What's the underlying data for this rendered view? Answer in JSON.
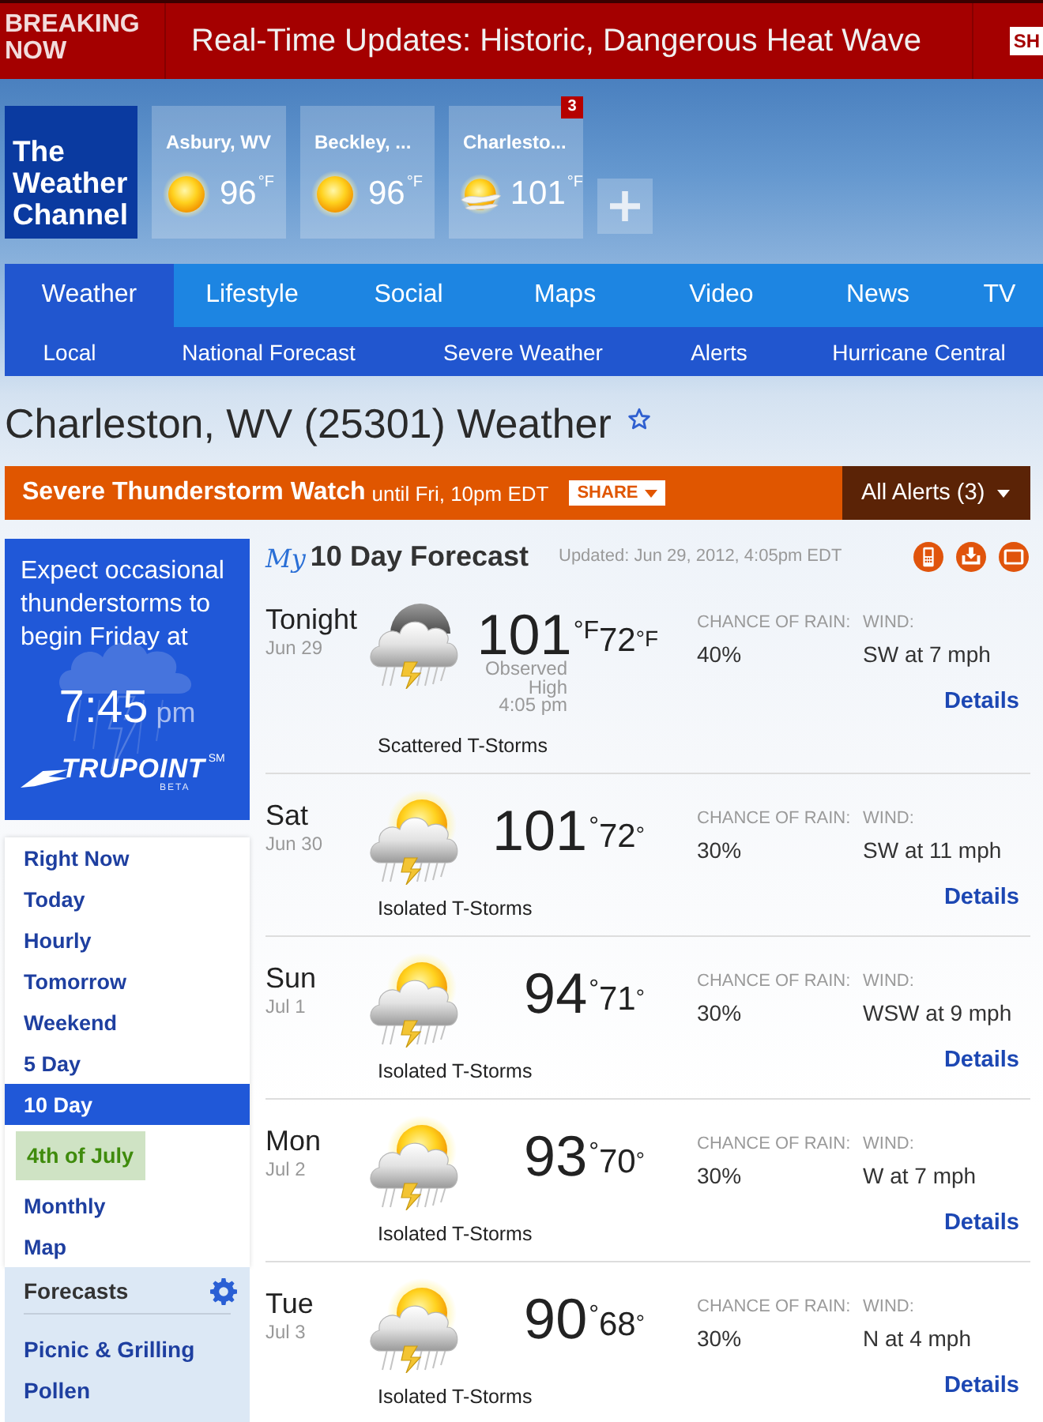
{
  "breaking": {
    "label": "BREAKING NOW",
    "headline": "Real-Time Updates: Historic, Dangerous Heat Wave",
    "share": "SH"
  },
  "logo": {
    "text": "The Weather Channel"
  },
  "locations": [
    {
      "name": "Asbury, WV",
      "temp": "96",
      "unit": "°F",
      "hazy": false
    },
    {
      "name": "Beckley, ...",
      "temp": "96",
      "unit": "°F",
      "hazy": false
    },
    {
      "name": "Charlesto...",
      "temp": "101",
      "unit": "°F",
      "hazy": true,
      "badge": "3"
    }
  ],
  "nav": {
    "tabs": [
      {
        "label": "Weather",
        "selected": true
      },
      {
        "label": "Lifestyle",
        "selected": false
      },
      {
        "label": "Social",
        "selected": false
      },
      {
        "label": "Maps",
        "selected": false
      },
      {
        "label": "Video",
        "selected": false
      },
      {
        "label": "News",
        "selected": false
      },
      {
        "label": "TV",
        "selected": false
      }
    ],
    "subnav": [
      "Local",
      "National Forecast",
      "Severe Weather",
      "Alerts",
      "Hurricane Central"
    ]
  },
  "page_title": "Charleston, WV (25301) Weather",
  "alert": {
    "title": "Severe Thunderstorm Watch",
    "until": "until Fri, 10pm EDT",
    "share": "SHARE",
    "all_alerts": "All Alerts (3)"
  },
  "trupoint": {
    "message": "Expect occasional thunderstorms to begin Friday at",
    "time": "7:45",
    "period": "pm",
    "brand": "TRUPOINT",
    "service_mark": "SM",
    "tag": "BETA"
  },
  "sidebar": {
    "items": [
      {
        "label": "Right Now",
        "kind": "link",
        "selected": false
      },
      {
        "label": "Today",
        "kind": "link",
        "selected": false
      },
      {
        "label": "Hourly",
        "kind": "link",
        "selected": false
      },
      {
        "label": "Tomorrow",
        "kind": "link",
        "selected": false
      },
      {
        "label": "Weekend",
        "kind": "link",
        "selected": false
      },
      {
        "label": "5 Day",
        "kind": "link",
        "selected": false
      },
      {
        "label": "10 Day",
        "kind": "link",
        "selected": true
      },
      {
        "label": "4th of July",
        "kind": "promo",
        "selected": false
      },
      {
        "label": "Monthly",
        "kind": "link",
        "selected": false
      },
      {
        "label": "Map",
        "kind": "link",
        "selected": false
      }
    ],
    "forecasts": {
      "title": "Forecasts",
      "links": [
        "Picnic & Grilling",
        "Pollen"
      ]
    }
  },
  "forecast": {
    "my": "My",
    "title": "10 Day Forecast",
    "updated": "Updated: Jun 29, 2012, 4:05pm EDT",
    "rows": [
      {
        "day": "Tonight",
        "date": "Jun 29",
        "night": true,
        "high": "101",
        "high_unit": "°F",
        "low": "72",
        "low_unit": "°F",
        "observed": [
          "Observed",
          "High",
          "4:05 pm"
        ],
        "condition": "Scattered T-Storms",
        "rain_label": "CHANCE OF RAIN:",
        "rain": "40%",
        "wind_label": "WIND:",
        "wind": "SW at 7 mph",
        "details": "Details"
      },
      {
        "day": "Sat",
        "date": "Jun 30",
        "night": false,
        "high": "101",
        "high_unit": "°",
        "low": "72",
        "low_unit": "°",
        "condition": "Isolated T-Storms",
        "rain_label": "CHANCE OF RAIN:",
        "rain": "30%",
        "wind_label": "WIND:",
        "wind": "SW at 11 mph",
        "details": "Details"
      },
      {
        "day": "Sun",
        "date": "Jul 1",
        "night": false,
        "high": "94",
        "high_unit": "°",
        "low": "71",
        "low_unit": "°",
        "condition": "Isolated T-Storms",
        "rain_label": "CHANCE OF RAIN:",
        "rain": "30%",
        "wind_label": "WIND:",
        "wind": "WSW at 9 mph",
        "details": "Details"
      },
      {
        "day": "Mon",
        "date": "Jul 2",
        "night": false,
        "high": "93",
        "high_unit": "°",
        "low": "70",
        "low_unit": "°",
        "condition": "Isolated T-Storms",
        "rain_label": "CHANCE OF RAIN:",
        "rain": "30%",
        "wind_label": "WIND:",
        "wind": "W at 7 mph",
        "details": "Details"
      },
      {
        "day": "Tue",
        "date": "Jul 3",
        "night": false,
        "high": "90",
        "high_unit": "°",
        "low": "68",
        "low_unit": "°",
        "condition": "Isolated T-Storms",
        "rain_label": "CHANCE OF RAIN:",
        "rain": "30%",
        "wind_label": "WIND:",
        "wind": "N at 4 mph",
        "details": "Details"
      }
    ]
  }
}
